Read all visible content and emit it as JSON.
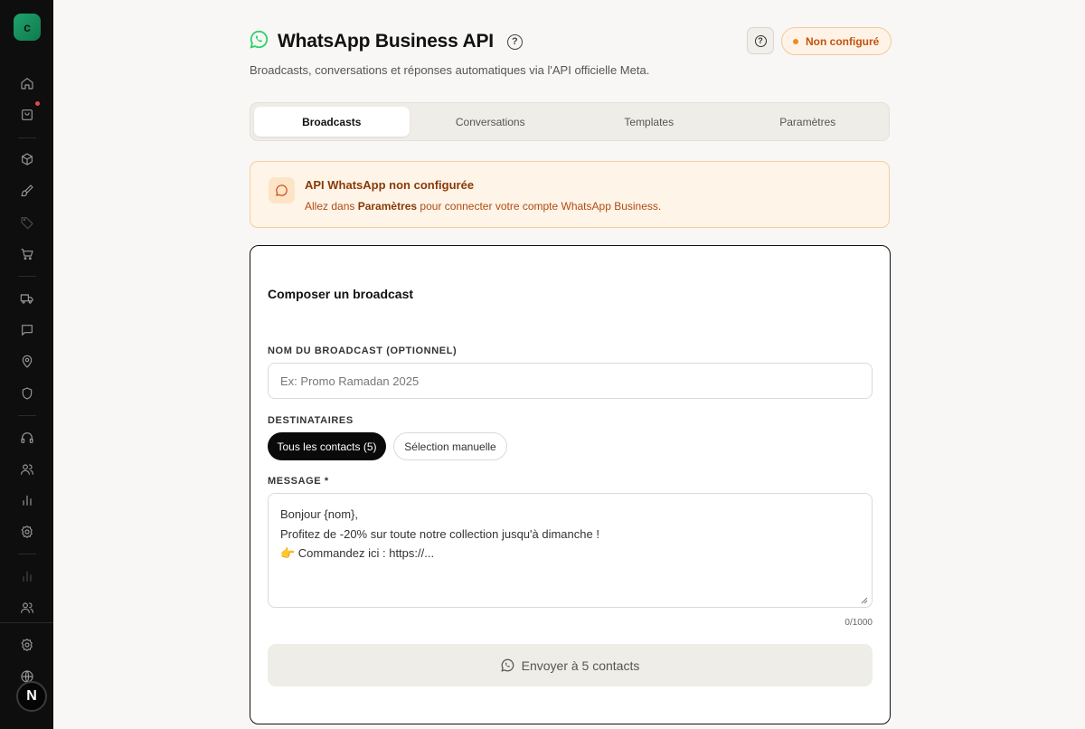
{
  "app": {
    "logo_letter": "c",
    "user_initial": "N"
  },
  "header": {
    "title": "WhatsApp Business API",
    "subtitle": "Broadcasts, conversations et réponses automatiques via l'API officielle Meta.",
    "status": "Non configuré",
    "help_icon": "help-circle-icon"
  },
  "tabs": [
    {
      "label": "Broadcasts",
      "active": true
    },
    {
      "label": "Conversations",
      "active": false
    },
    {
      "label": "Templates",
      "active": false
    },
    {
      "label": "Paramètres",
      "active": false
    }
  ],
  "alert": {
    "title": "API WhatsApp non configurée",
    "text_prefix": "Allez dans ",
    "text_link": "Paramètres",
    "text_suffix": " pour connecter votre compte WhatsApp Business."
  },
  "composer": {
    "title": "Composer un broadcast",
    "name_label": "NOM DU BROADCAST (OPTIONNEL)",
    "name_placeholder": "Ex: Promo Ramadan 2025",
    "recipients_label": "DESTINATAIRES",
    "recipients_all": "Tous les contacts (5)",
    "recipients_manual": "Sélection manuelle",
    "message_label": "MESSAGE *",
    "message_lines": [
      "Bonjour {nom},",
      "",
      "Profitez de -20% sur toute notre collection jusqu'à dimanche !",
      "",
      "👉 Commandez ici : https://..."
    ],
    "counter": "0/1000",
    "send_label": "Envoyer à 5 contacts"
  },
  "colors": {
    "accent": "#25D366",
    "warning": "#f08a24",
    "sidebar_bg": "#0e0e0e"
  },
  "sidebar_icons": [
    "home-icon",
    "shopping-bag-icon",
    "box-icon",
    "brush-icon",
    "tag-icon",
    "cart-icon",
    "truck-icon",
    "message-icon",
    "map-pin-icon",
    "shield-icon",
    "headphones-icon",
    "users-icon",
    "bar-chart-icon",
    "gear-icon",
    "bar-chart-icon",
    "users-icon",
    "gear-icon",
    "globe-icon"
  ]
}
